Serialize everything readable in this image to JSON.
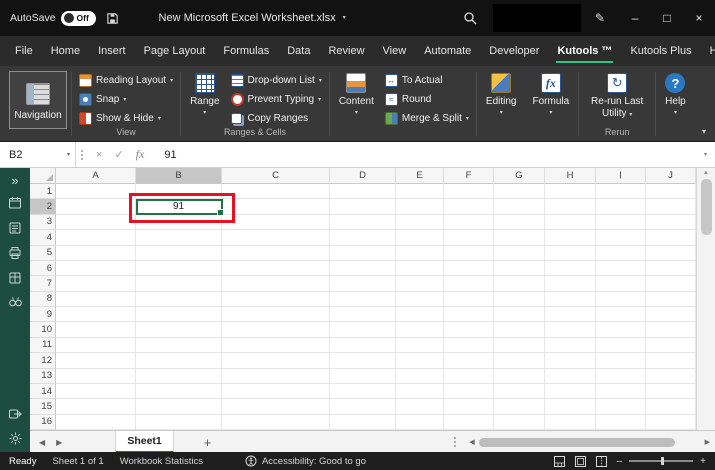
{
  "titlebar": {
    "autosave_label": "AutoSave",
    "autosave_state": "Off",
    "document_title": "New Microsoft Excel Worksheet.xlsx"
  },
  "menu": {
    "tabs": [
      "File",
      "Home",
      "Insert",
      "Page Layout",
      "Formulas",
      "Data",
      "Review",
      "View",
      "Automate",
      "Developer",
      "Kutools ™",
      "Kutools Plus",
      "Help"
    ],
    "active_tab": "Kutools ™"
  },
  "ribbon": {
    "navigation_label": "Navigation",
    "view_group": {
      "label": "View",
      "reading_layout": "Reading Layout",
      "snap": "Snap",
      "show_hide": "Show & Hide"
    },
    "ranges_cells_group": {
      "label": "Ranges & Cells",
      "range": "Range",
      "dropdown_list": "Drop-down List",
      "prevent_typing": "Prevent Typing",
      "copy_ranges": "Copy Ranges"
    },
    "content_label": "Content",
    "to_actual": "To Actual",
    "round": "Round",
    "merge_split": "Merge & Split",
    "editing_label": "Editing",
    "formula_label": "Formula",
    "rerun_group": {
      "label": "Rerun",
      "rerun_last_utility": "Re-run Last Utility"
    },
    "help_label": "Help"
  },
  "formula_bar": {
    "name_box": "B2",
    "fx_label": "fx",
    "value": "91"
  },
  "grid": {
    "columns": [
      "A",
      "B",
      "C",
      "D",
      "E",
      "F",
      "G",
      "H",
      "I",
      "J"
    ],
    "rows": [
      "1",
      "2",
      "3",
      "4",
      "5",
      "6",
      "7",
      "8",
      "9",
      "10",
      "11",
      "12",
      "13",
      "14",
      "15",
      "16"
    ],
    "selected_column": "B",
    "selected_row": "2",
    "selected_cell": {
      "ref": "B2",
      "value": "91"
    }
  },
  "sheet_bar": {
    "active_sheet": "Sheet1"
  },
  "status_bar": {
    "mode": "Ready",
    "sheet_info": "Sheet 1 of 1",
    "workbook_statistics": "Workbook Statistics",
    "accessibility": "Accessibility: Good to go"
  },
  "colors": {
    "accent_green": "#217346",
    "tab_underline": "#33c481",
    "selection_border": "#217346",
    "annotation_red": "#e81123",
    "share_button": "#2e9e5b",
    "sidebar_green": "#1d4c41"
  }
}
